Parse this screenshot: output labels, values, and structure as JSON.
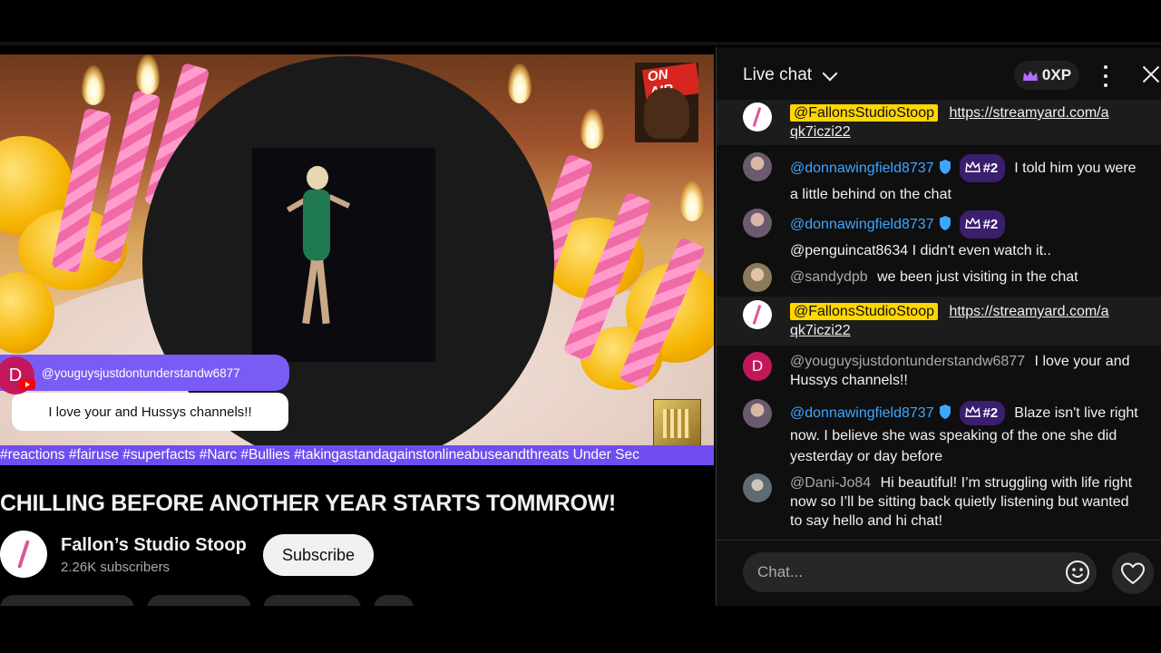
{
  "video": {
    "onair_label": "ON AIR",
    "overlay_author": "@youguysjustdontunderstandw6877",
    "overlay_avatar_letter": "D",
    "overlay_message": "I love your and Hussys channels!!",
    "ticker": "#reactions #fairuse #superfacts #Narc #Bullies #takingastandagainstonlineabuseandthreats Under Sec"
  },
  "title": "CHILLING BEFORE ANOTHER YEAR STARTS TOMMROW!",
  "channel": {
    "name": "Fallon’s Studio Stoop",
    "subscribers": "2.26K subscribers",
    "subscribe_label": "Subscribe"
  },
  "chat": {
    "title": "Live chat",
    "xp": "0XP",
    "input_placeholder": "Chat...",
    "messages": [
      {
        "author": "@FallonsStudioStoop",
        "link": "https://streamyard.com/aqk7iczi22",
        "link_l1": "https://streamyard.com/a",
        "link_l2": "qk7iczi22"
      },
      {
        "author": "@donnawingfield8737",
        "rank": "#2",
        "text": "I told him you were a little behind on the chat"
      },
      {
        "author": "@donnawingfield8737",
        "rank": "#2",
        "text": "@penguincat8634 I didn't even watch it.."
      },
      {
        "author": "@sandydpb",
        "text": "we been just visiting in the chat"
      },
      {
        "author": "@FallonsStudioStoop",
        "link": "https://streamyard.com/aqk7iczi22",
        "link_l1": "https://streamyard.com/a",
        "link_l2": "qk7iczi22"
      },
      {
        "author": "@youguysjustdontunderstandw6877",
        "avatar_letter": "D",
        "text": "I love your and Hussys channels!!"
      },
      {
        "author": "@donnawingfield8737",
        "rank": "#2",
        "text": "Blaze isn't live right now. I believe she was speaking of the one she did yesterday or day before"
      },
      {
        "author": "@Dani-Jo84",
        "text": "Hi beautiful! I’m struggling with life right now so I’ll be sitting back quietly listening but wanted to say hello and hi chat!"
      }
    ]
  },
  "colors": {
    "chat_bg": "#0f0f0f",
    "owner_badge": "#ffd600",
    "member_name": "#3ea6ff",
    "overlay_purple": "#7a5bf5"
  }
}
